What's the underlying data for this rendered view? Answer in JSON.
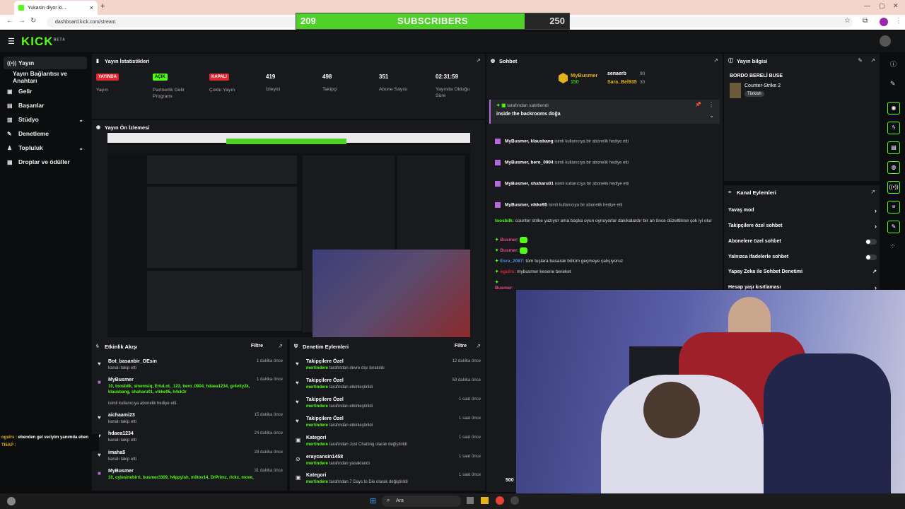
{
  "browser": {
    "tab_title": "Yukasin diyor ki...",
    "url": "dashboard.kick.com/stream"
  },
  "subscriber_goal": {
    "current": "209",
    "label": "SUBSCRIBERS",
    "goal": "250",
    "progress": 0.836
  },
  "sidebar": {
    "items": [
      {
        "label": "Yayın"
      },
      {
        "label": "Yayın Bağlantısı ve Anahtarı"
      },
      {
        "label": "Gelir"
      },
      {
        "label": "Başarılar"
      },
      {
        "label": "Stüdyo"
      },
      {
        "label": "Denetleme"
      },
      {
        "label": "Topluluk"
      },
      {
        "label": "Droplar ve ödüller"
      }
    ]
  },
  "stats": {
    "title": "Yayın İstatistikleri",
    "items": [
      {
        "badge": "YAYINDA",
        "label": "Yayın"
      },
      {
        "badge": "AÇIK",
        "label": "Partnerlik Gelir Programı"
      },
      {
        "badge": "KAPALI",
        "label": "Çoklu Yayın"
      },
      {
        "value": "419",
        "label": "İzleyici"
      },
      {
        "value": "498",
        "label": "Takipçi"
      },
      {
        "value": "351",
        "label": "Abone Sayısı"
      },
      {
        "value": "02:31:59",
        "label": "Yayında Olduğu Süre"
      }
    ]
  },
  "preview": {
    "title": "Yayın Ön İzlemesi"
  },
  "activity": {
    "title": "Etkinlik Akışı",
    "filter": "Filtre",
    "events": [
      {
        "name": "Bot_basanbir_OEsin",
        "sub": "kanalı takip etti",
        "time": "1 dakika önce"
      },
      {
        "name": "MyBusmer",
        "sub": "10, toosbilk, sinemsiq, ErtuLoL_123, bero_0904, hdaea1234, gr4vity2k, klausbang, shaharu01, vikke95, h4ck3r",
        "sub2": "isimli kullanıcıya abonelik hediye etti.",
        "time": "1 dakika önce"
      },
      {
        "name": "aichaami23",
        "sub": "kanalı takip etti",
        "time": "15 dakika önce"
      },
      {
        "name": "hdaea1234",
        "sub": "kanalı takip etti",
        "time": "24 dakika önce"
      },
      {
        "name": "imaha5",
        "sub": "kanalı takip etti",
        "time": "28 dakika önce"
      },
      {
        "name": "MyBusmer",
        "sub": "10, oylesinebirri, busmer3309, h4ppyish, miltov14, DrPrimz, rickx, move,",
        "time": "31 dakika önce"
      }
    ]
  },
  "moderation": {
    "title": "Denetim Eylemleri",
    "filter": "Filtre",
    "events": [
      {
        "name": "Takipçilere Özel",
        "user": "mertindere",
        "sub": "tarafından devre dışı bırakıldı",
        "time": "12 dakika önce"
      },
      {
        "name": "Takipçilere Özel",
        "user": "mertindere",
        "sub": "tarafından etkinleştirildi",
        "time": "59 dakika önce"
      },
      {
        "name": "Takipçilere Özel",
        "user": "mertindere",
        "sub": "tarafından etkinleştirildi",
        "time": "1 saat önce"
      },
      {
        "name": "Takipçilere Özel",
        "user": "mertindere",
        "sub": "tarafından etkinleştirildi",
        "time": "1 saat önce"
      },
      {
        "name": "Kategori",
        "user": "mertindere",
        "sub": "tarafından Just Chatting olarak değiştirildi",
        "time": "1 saat önce"
      },
      {
        "name": "eraycansin1458",
        "user": "mertindere",
        "sub": "tarafından yasaklandı",
        "time": "1 saat önce"
      },
      {
        "name": "Kategori",
        "user": "mertindere",
        "sub": "tarafından 7 Days to Die olarak değiştirildi",
        "time": "1 saat önce"
      }
    ]
  },
  "chat": {
    "title": "Sohbet",
    "top": [
      {
        "name": "MyBusmer",
        "value": "150"
      },
      {
        "name": "senaerb",
        "value": "90"
      },
      {
        "name": "Sara_Bel935",
        "value": "30"
      }
    ],
    "pinned_by": "tarafından sabitlendi",
    "pinned_text": "inside the backrooms doğa",
    "gifts": [
      {
        "user": "MyBusmer",
        "target": "klausbang",
        "text": "isimli kullanıcıya bir abonelik hediye etti"
      },
      {
        "user": "MyBusmer",
        "target": "bero_0904",
        "text": "isimli kullanıcıya bir abonelik hediye etti"
      },
      {
        "user": "MyBusmer",
        "target": "shaharu01",
        "text": "isimli kullanıcıya bir abonelik hediye etti"
      },
      {
        "user": "MyBusmer",
        "target": "vikke95",
        "text": "isimli kullanıcıya bir abonelik hediye etti"
      }
    ],
    "messages": [
      {
        "user": "toosbilk:",
        "text": "counter strike yazıyor ama başka oyun oynuyorlar dakikalardır bir an önce düzeltilirse çok iyi olur"
      },
      {
        "user": "Busmer:",
        "text": ""
      },
      {
        "user": "Busmer:",
        "text": ""
      },
      {
        "user": "Esra_2087:",
        "text": "tüm tuşlara basarak bölüm geçmeye çalışıyoruz"
      },
      {
        "user": "ogulrs:",
        "text": "mybusmer kesene bereket"
      },
      {
        "user": "Busmer:",
        "text": ""
      }
    ],
    "count": "500"
  },
  "stream_info": {
    "title": "Yayın bilgisi",
    "stream_title": "BORDO BERELİ BUSE",
    "category": "Counter-Strike 2",
    "tag": "Türkish"
  },
  "channel_actions": {
    "title": "Kanal Eylemleri",
    "items": [
      "Yavaş mod",
      "Takipçilere özel sohbet",
      "Abonelere özel sohbet",
      "Yalnızca ifadelerle sohbet",
      "Yapay Zeka ile Sohbet Denetimi",
      "Hesap yaşı kısıtlaması"
    ]
  },
  "overlay_chat": [
    {
      "user": "ogulrs :",
      "text": "ebenden gel veriyim yanımda eben"
    },
    {
      "user": "TI5AP :",
      "text": ""
    }
  ],
  "taskbar": {
    "search": "Ara"
  },
  "colors": {
    "accent": "#53fc18",
    "live": "#e0292f",
    "panel": "#18191c"
  }
}
